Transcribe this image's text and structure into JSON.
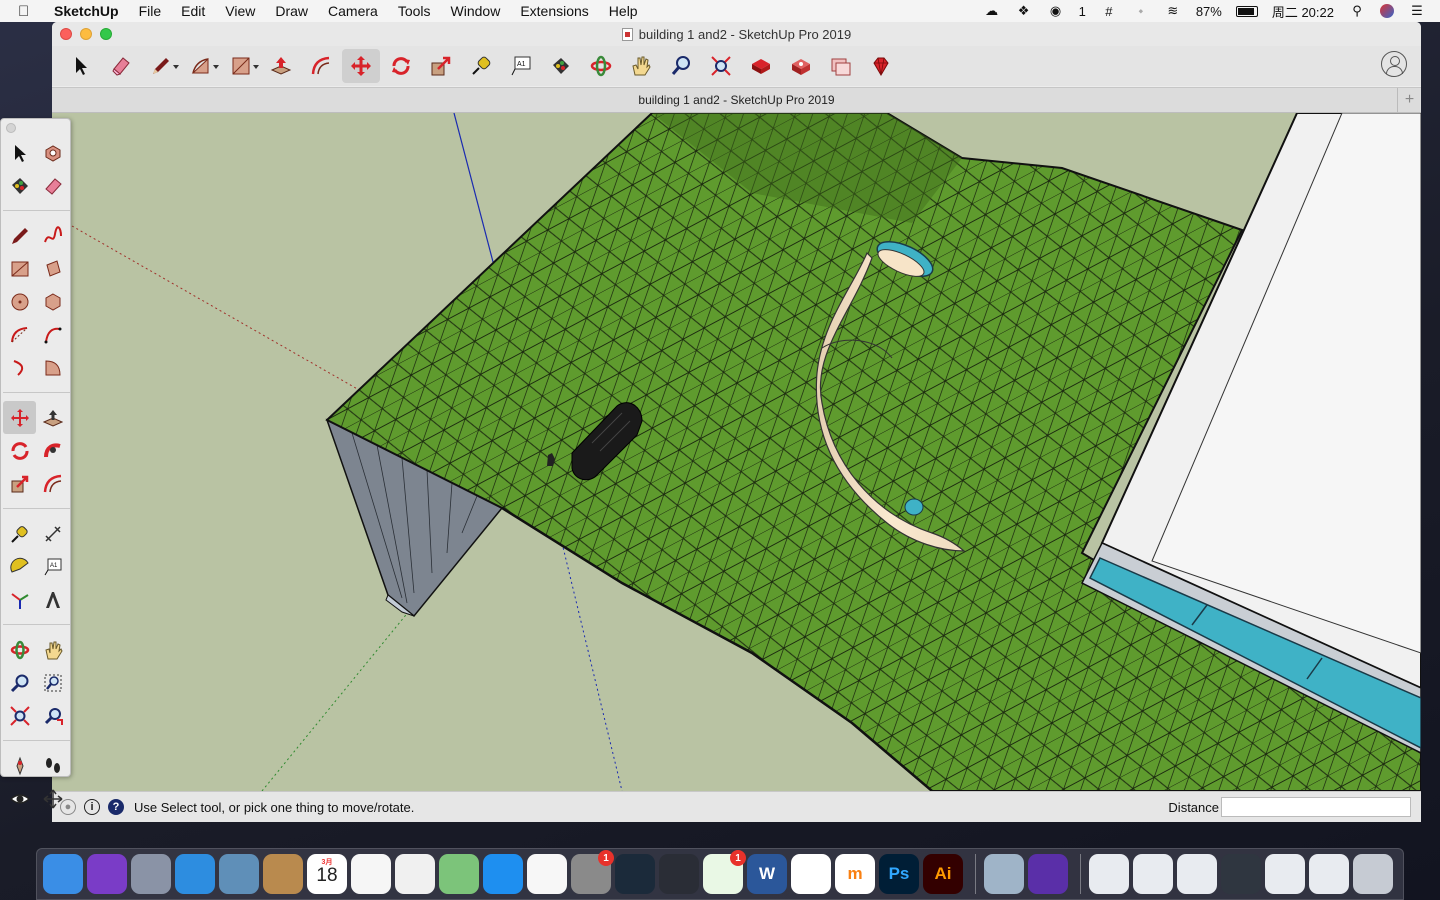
{
  "menubar": {
    "app_name": "SketchUp",
    "menus": [
      "File",
      "Edit",
      "View",
      "Draw",
      "Camera",
      "Tools",
      "Window",
      "Extensions",
      "Help"
    ],
    "status_items": {
      "wechat_count": "1",
      "battery": "87%",
      "clock": "周二 20:22"
    }
  },
  "window": {
    "title": "building 1 and2 - SketchUp Pro 2019",
    "tab_title": "building 1 and2 - SketchUp Pro 2019",
    "tab_plus": "+"
  },
  "toolbar": {
    "tools": [
      {
        "name": "select-tool",
        "icon": "arrow-icon"
      },
      {
        "name": "eraser-tool",
        "icon": "eraser-icon"
      },
      {
        "name": "line-tool",
        "icon": "pencil-icon"
      },
      {
        "name": "arc-tool",
        "icon": "arc-icon"
      },
      {
        "name": "rectangle-tool",
        "icon": "rectangle-icon"
      },
      {
        "name": "push-pull-tool",
        "icon": "push-pull-icon"
      },
      {
        "name": "offset-tool",
        "icon": "offset-icon"
      },
      {
        "name": "move-tool",
        "icon": "move-icon"
      },
      {
        "name": "rotate-tool",
        "icon": "rotate-icon"
      },
      {
        "name": "scale-tool",
        "icon": "scale-icon"
      },
      {
        "name": "tape-measure-tool",
        "icon": "tape-measure-icon"
      },
      {
        "name": "text-tool",
        "icon": "text-icon"
      },
      {
        "name": "paint-bucket-tool",
        "icon": "paint-bucket-icon"
      },
      {
        "name": "orbit-tool",
        "icon": "orbit-icon"
      },
      {
        "name": "pan-tool",
        "icon": "hand-icon"
      },
      {
        "name": "zoom-tool",
        "icon": "magnifier-icon"
      },
      {
        "name": "zoom-extents-tool",
        "icon": "zoom-extents-icon"
      },
      {
        "name": "3d-warehouse-button",
        "icon": "warehouse-icon"
      },
      {
        "name": "extension-warehouse-button",
        "icon": "extension-warehouse-icon"
      },
      {
        "name": "send-to-layout-button",
        "icon": "layout-icon"
      },
      {
        "name": "extension-manager-button",
        "icon": "ruby-icon"
      }
    ],
    "text_icon_label": "A1"
  },
  "palette": {
    "rows": [
      [
        {
          "name": "select-tool",
          "icon": "arrow-icon"
        },
        {
          "name": "make-component-tool",
          "icon": "component-icon"
        }
      ],
      [
        {
          "name": "paint-bucket-tool",
          "icon": "paint-bucket-icon"
        },
        {
          "name": "eraser-tool",
          "icon": "eraser-icon"
        }
      ],
      "gap",
      [
        {
          "name": "line-tool",
          "icon": "pencil-icon"
        },
        {
          "name": "freehand-tool",
          "icon": "freehand-icon"
        }
      ],
      [
        {
          "name": "rectangle-tool",
          "icon": "rectangle-icon"
        },
        {
          "name": "rotated-rectangle-tool",
          "icon": "rotated-rectangle-icon"
        }
      ],
      [
        {
          "name": "circle-tool",
          "icon": "circle-icon"
        },
        {
          "name": "polygon-tool",
          "icon": "polygon-icon"
        }
      ],
      [
        {
          "name": "arc-tool",
          "icon": "arc-icon"
        },
        {
          "name": "two-point-arc-tool",
          "icon": "two-point-arc-icon"
        }
      ],
      [
        {
          "name": "three-point-arc-tool",
          "icon": "three-point-arc-icon"
        },
        {
          "name": "pie-tool",
          "icon": "pie-icon"
        }
      ],
      "gap",
      [
        {
          "name": "move-tool",
          "icon": "move-icon"
        },
        {
          "name": "push-pull-tool",
          "icon": "push-pull-icon"
        }
      ],
      [
        {
          "name": "rotate-tool",
          "icon": "rotate-icon"
        },
        {
          "name": "follow-me-tool",
          "icon": "follow-me-icon"
        }
      ],
      [
        {
          "name": "scale-tool",
          "icon": "scale-icon"
        },
        {
          "name": "offset-tool",
          "icon": "offset-icon"
        }
      ],
      "gap",
      [
        {
          "name": "tape-measure-tool",
          "icon": "tape-measure-icon"
        },
        {
          "name": "dimension-tool",
          "icon": "dimension-icon"
        }
      ],
      [
        {
          "name": "protractor-tool",
          "icon": "protractor-icon"
        },
        {
          "name": "text-tool",
          "icon": "text-icon"
        }
      ],
      [
        {
          "name": "axes-tool",
          "icon": "axes-icon"
        },
        {
          "name": "3d-text-tool",
          "icon": "3d-text-icon"
        }
      ],
      "gap",
      [
        {
          "name": "orbit-tool",
          "icon": "orbit-icon"
        },
        {
          "name": "pan-tool",
          "icon": "hand-icon"
        }
      ],
      [
        {
          "name": "zoom-tool",
          "icon": "magnifier-icon"
        },
        {
          "name": "zoom-window-tool",
          "icon": "zoom-window-icon"
        }
      ],
      [
        {
          "name": "zoom-extents-tool",
          "icon": "zoom-extents-icon"
        },
        {
          "name": "previous-view-tool",
          "icon": "previous-view-icon"
        }
      ],
      "gap",
      [
        {
          "name": "position-camera-tool",
          "icon": "position-camera-icon"
        },
        {
          "name": "walk-tool",
          "icon": "footprints-icon"
        }
      ],
      [
        {
          "name": "look-around-tool",
          "icon": "eye-icon"
        },
        {
          "name": "section-plane-tool",
          "icon": "section-plane-icon"
        }
      ]
    ]
  },
  "status": {
    "message": "Use Select tool, or pick one thing to move/rotate.",
    "vcb_label": "Distance",
    "vcb_value": ""
  },
  "dock": {
    "apps": [
      {
        "name": "finder",
        "icon": "finder-icon",
        "color": "#3a8ee6",
        "running": true
      },
      {
        "name": "siri",
        "icon": "siri-icon",
        "color": "#7a3cc7"
      },
      {
        "name": "launchpad",
        "icon": "rocket-icon",
        "color": "#8a93a6"
      },
      {
        "name": "safari",
        "icon": "compass-icon",
        "color": "#2d8de0",
        "running": true
      },
      {
        "name": "preview",
        "icon": "preview-icon",
        "color": "#5f8fb8"
      },
      {
        "name": "contacts",
        "icon": "contacts-icon",
        "color": "#b98a4e"
      },
      {
        "name": "calendar",
        "icon": "calendar-icon",
        "color": "#ffffff",
        "month": "3月",
        "day": "18"
      },
      {
        "name": "reminders",
        "icon": "reminders-icon",
        "color": "#f6f6f6"
      },
      {
        "name": "photos",
        "icon": "photos-icon",
        "color": "#f0f0f0"
      },
      {
        "name": "maps",
        "icon": "maps-icon",
        "color": "#7cc47a"
      },
      {
        "name": "app-store",
        "icon": "app-store-icon",
        "color": "#1e8ff0"
      },
      {
        "name": "itunes",
        "icon": "music-icon",
        "color": "#f7f7f7"
      },
      {
        "name": "system-preferences",
        "icon": "gear-icon",
        "color": "#8a8a8a",
        "badge": "1",
        "running": true
      },
      {
        "name": "league-of-legends",
        "icon": "game-icon",
        "color": "#1b2a3a"
      },
      {
        "name": "quicktime",
        "icon": "quicktime-icon",
        "color": "#2a2d36",
        "running": true
      },
      {
        "name": "wechat",
        "icon": "wechat-icon",
        "color": "#e9f8e5",
        "badge": "1",
        "running": true
      },
      {
        "name": "word",
        "icon": "word-icon",
        "color": "#2b579a",
        "label": "W",
        "running": true
      },
      {
        "name": "sketchup",
        "icon": "sketchup-icon",
        "color": "#ffffff",
        "running": true
      },
      {
        "name": "moodle",
        "icon": "moodle-icon",
        "color": "#ffffff",
        "label": "m",
        "running": true
      },
      {
        "name": "photoshop",
        "icon": "photoshop-icon",
        "color": "#001e36",
        "label": "Ps"
      },
      {
        "name": "illustrator",
        "icon": "illustrator-icon",
        "color": "#330000",
        "label": "Ai"
      },
      "sep",
      {
        "name": "screenshot-folder",
        "icon": "folder-icon",
        "color": "#9fb4c8"
      },
      {
        "name": "imovie",
        "icon": "star-icon",
        "color": "#5a2fa8"
      },
      "sep",
      {
        "name": "recent-file-1",
        "icon": "document-thumbnail-icon",
        "color": "#e8ebf0"
      },
      {
        "name": "recent-file-2",
        "icon": "document-thumbnail-icon",
        "color": "#e8ebf0"
      },
      {
        "name": "recent-file-3",
        "icon": "document-thumbnail-icon",
        "color": "#e8ebf0"
      },
      {
        "name": "recent-file-4",
        "icon": "document-thumbnail-icon",
        "color": "#2f3640"
      },
      {
        "name": "recent-file-5",
        "icon": "document-thumbnail-icon",
        "color": "#e8ebf0"
      },
      {
        "name": "recent-file-6",
        "icon": "document-thumbnail-icon",
        "color": "#e8ebf0"
      },
      {
        "name": "trash",
        "icon": "trash-icon",
        "color": "#c6cbd3"
      }
    ]
  },
  "colors": {
    "sky": "#b9c3a3",
    "terrain": "#5f9b2e",
    "terrain_dark": "#4a7f22",
    "slide": "#f7e4c8",
    "pool": "#3fb2c6",
    "building": "#f2f2f2",
    "accent_red": "#d8232a"
  }
}
